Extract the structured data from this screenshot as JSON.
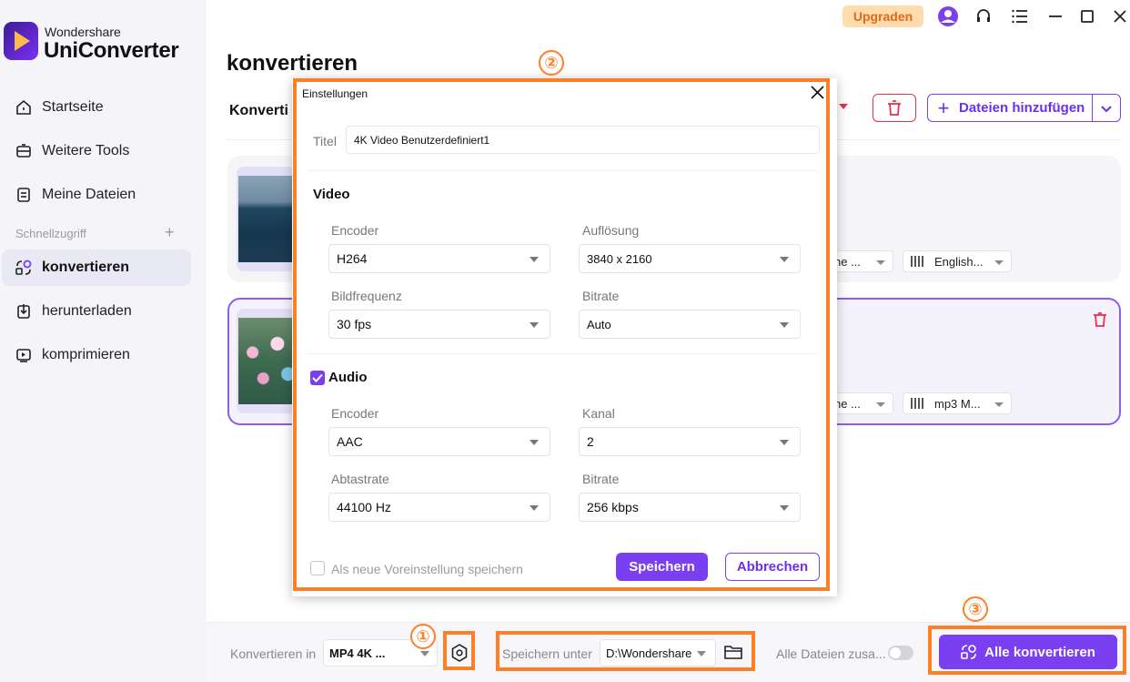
{
  "app": {
    "brand_top": "Wondershare",
    "brand_main": "UniConverter"
  },
  "sidebar": {
    "items": [
      {
        "label": "Startseite",
        "icon": "home-icon"
      },
      {
        "label": "Weitere Tools",
        "icon": "toolbox-icon"
      },
      {
        "label": "Meine Dateien",
        "icon": "files-icon"
      }
    ],
    "quick_access_label": "Schnellzugriff",
    "quick_items": [
      {
        "label": "konvertieren",
        "icon": "convert-icon",
        "active": true
      },
      {
        "label": "herunterladen",
        "icon": "download-icon"
      },
      {
        "label": "komprimieren",
        "icon": "compress-icon"
      }
    ]
  },
  "header": {
    "upgrade_label": "Upgraden",
    "icons": [
      "avatar-icon",
      "headset-icon",
      "menu-icon",
      "minimize-icon",
      "maximize-icon",
      "close-icon"
    ]
  },
  "main": {
    "page_title": "konvertieren",
    "tab_label": "Konverti",
    "add_files_label": "Dateien hinzufügen",
    "files": [
      {
        "subtitle_select": "ne ...",
        "audio_select": "English..."
      },
      {
        "subtitle_select": "ne ...",
        "audio_select": "mp3 M..."
      }
    ]
  },
  "dialog": {
    "title": "Einstellungen",
    "title_field_label": "Titel",
    "title_field_value": "4K Video Benutzerdefiniert1",
    "video_section": "Video",
    "audio_section": "Audio",
    "audio_checked": true,
    "video": {
      "encoder_label": "Encoder",
      "encoder_value": "H264",
      "resolution_label": "Auflösung",
      "resolution_value": "3840 x 2160",
      "framerate_label": "Bildfrequenz",
      "framerate_value": "30 fps",
      "bitrate_label": "Bitrate",
      "bitrate_value": "Auto"
    },
    "audio": {
      "encoder_label": "Encoder",
      "encoder_value": "AAC",
      "channel_label": "Kanal",
      "channel_value": "2",
      "samplerate_label": "Abtastrate",
      "samplerate_value": "44100 Hz",
      "bitrate_label": "Bitrate",
      "bitrate_value": "256 kbps"
    },
    "save_preset_label": "Als neue Voreinstellung speichern",
    "save_label": "Speichern",
    "cancel_label": "Abbrechen"
  },
  "bottom": {
    "convert_in_label": "Konvertieren in",
    "format_value": "MP4 4K ...",
    "save_in_label": "Speichern unter",
    "path_value": "D:\\Wondershare",
    "merge_label": "Alle Dateien zusa...",
    "convert_all_label": "Alle konvertieren"
  },
  "annotations": {
    "markers": [
      "①",
      "②",
      "③"
    ],
    "color": "#ff7f27"
  },
  "colors": {
    "accent": "#7b3ff2",
    "danger": "#e5334a",
    "upgrade_bg": "#ffdcae"
  }
}
